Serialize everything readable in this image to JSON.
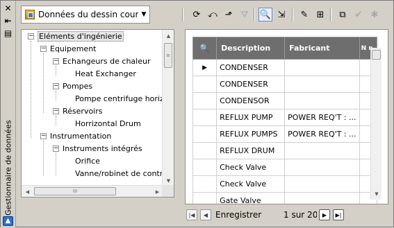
{
  "palette": {
    "title": "Gestionnaire de données",
    "close_icon": "close-icon",
    "autohide_icon": "autohide-icon",
    "properties_icon": "properties-icon"
  },
  "toolbar": {
    "view_selector": "Données du dessin couran",
    "buttons": [
      {
        "name": "refresh-icon"
      },
      {
        "name": "reset-view-icon"
      },
      {
        "name": "navigate-up-icon"
      },
      {
        "name": "filter-icon"
      },
      {
        "name": "zoom-to-icon",
        "active": true
      },
      {
        "name": "export-icon"
      },
      {
        "name": "print-icon"
      },
      {
        "name": "import-icon"
      },
      {
        "name": "validate-icon"
      },
      {
        "name": "accept-icon",
        "disabled": true
      },
      {
        "name": "reject-icon",
        "disabled": true
      }
    ]
  },
  "tree": {
    "items": [
      {
        "label": "Eléments d'ingénierie",
        "expander": "−",
        "selected": true
      },
      {
        "label": "Equipement",
        "expander": "−"
      },
      {
        "label": "Echangeurs de chaleur",
        "expander": "−"
      },
      {
        "label": "Heat Exchanger",
        "expander": ""
      },
      {
        "label": "Pompes",
        "expander": "−"
      },
      {
        "label": "Pompe centrifuge horizont",
        "expander": ""
      },
      {
        "label": "Réservoirs",
        "expander": "−"
      },
      {
        "label": "Horrizontal Drum",
        "expander": ""
      },
      {
        "label": "Instrumentation",
        "expander": "−"
      },
      {
        "label": "Instruments intégrés",
        "expander": "−"
      },
      {
        "label": "Orifice",
        "expander": ""
      },
      {
        "label": "Vanne/robinet de contrôle",
        "expander": ""
      }
    ],
    "h_thumb_grip": "III"
  },
  "grid": {
    "zoom_icon": "zoom-icon",
    "columns": [
      "Description",
      "Fabricant",
      "N n"
    ],
    "rows": [
      {
        "current": true,
        "description": "CONDENSER",
        "fabricant": ""
      },
      {
        "current": false,
        "description": "CONDENSER",
        "fabricant": ""
      },
      {
        "current": false,
        "description": "CONDENSOR",
        "fabricant": ""
      },
      {
        "current": false,
        "description": "REFLUX PUMP",
        "fabricant": "POWER REQ'T : ..."
      },
      {
        "current": false,
        "description": "REFLUX PUMPS",
        "fabricant": "POWER REQ'T : ..."
      },
      {
        "current": false,
        "description": "REFLUX DRUM",
        "fabricant": ""
      },
      {
        "current": false,
        "description": "Check Valve",
        "fabricant": ""
      },
      {
        "current": false,
        "description": "Check Valve",
        "fabricant": ""
      },
      {
        "current": false,
        "description": "Gate Valve",
        "fabricant": ""
      }
    ]
  },
  "navigation": {
    "label": "Enregistrer",
    "count": "1 sur 20"
  }
}
